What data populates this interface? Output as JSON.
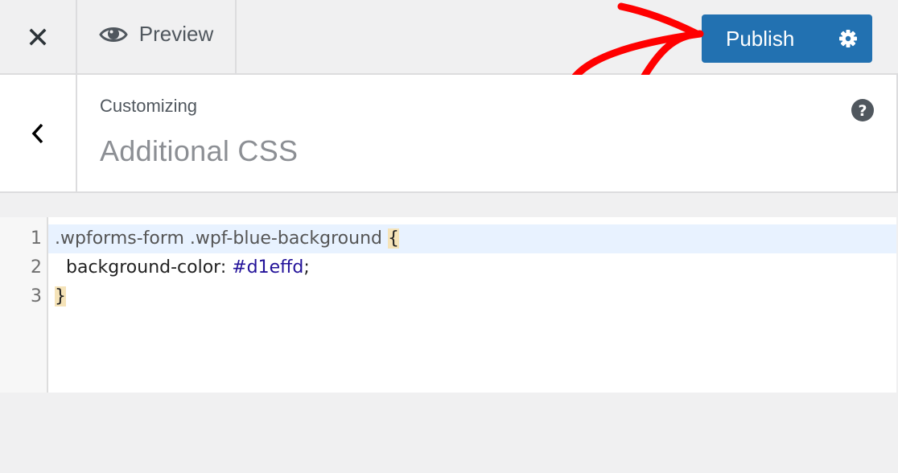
{
  "topbar": {
    "close_icon": "close-icon",
    "preview_label": "Preview",
    "preview_icon": "eye-icon",
    "publish_label": "Publish",
    "publish_settings_icon": "gear-icon",
    "accent_color": "#2271b1"
  },
  "header": {
    "back_icon": "chevron-left-icon",
    "breadcrumb": "Customizing",
    "title": "Additional CSS",
    "help_icon": "help-icon"
  },
  "editor": {
    "lines": [
      {
        "number": "1",
        "selector": ".wpforms-form .wpf-blue-background ",
        "open_brace": "{"
      },
      {
        "number": "2",
        "indent": "  ",
        "property": "background-color: ",
        "value": "#d1effd",
        "end": ";"
      },
      {
        "number": "3",
        "close_brace": "}"
      }
    ]
  },
  "annotation": {
    "type": "red-arrow",
    "points_to": "publish-button",
    "color": "#ff0000"
  }
}
